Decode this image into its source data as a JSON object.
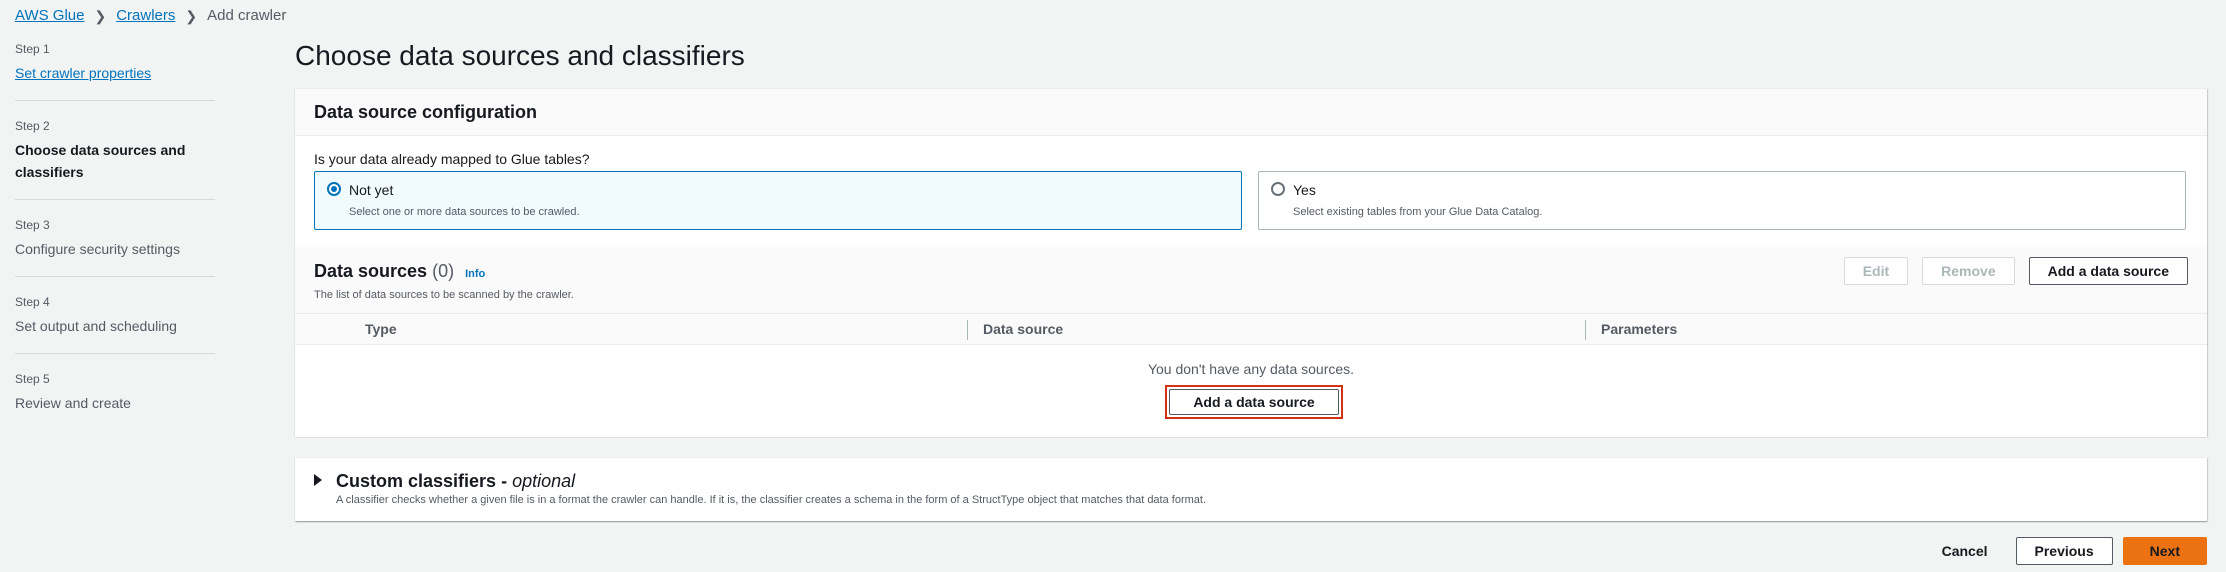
{
  "breadcrumb": {
    "items": [
      "AWS Glue",
      "Crawlers"
    ],
    "current": "Add crawler"
  },
  "steps": [
    {
      "num": "Step 1",
      "title": "Set crawler properties"
    },
    {
      "num": "Step 2",
      "title": "Choose data sources and classifiers"
    },
    {
      "num": "Step 3",
      "title": "Configure security settings"
    },
    {
      "num": "Step 4",
      "title": "Set output and scheduling"
    },
    {
      "num": "Step 5",
      "title": "Review and create"
    }
  ],
  "page_title": "Choose data sources and classifiers",
  "config": {
    "title": "Data source configuration",
    "question": "Is your data already mapped to Glue tables?",
    "options": [
      {
        "label": "Not yet",
        "desc": "Select one or more data sources to be crawled.",
        "selected": true
      },
      {
        "label": "Yes",
        "desc": "Select existing tables from your Glue Data Catalog.",
        "selected": false
      }
    ]
  },
  "data_sources": {
    "title": "Data sources",
    "count": "(0)",
    "info": "Info",
    "desc": "The list of data sources to be scanned by the crawler.",
    "edit": "Edit",
    "remove": "Remove",
    "add": "Add a data source",
    "columns": [
      "Type",
      "Data source",
      "Parameters"
    ],
    "empty_text": "You don't have any data sources.",
    "empty_add": "Add a data source"
  },
  "classifiers": {
    "title": "Custom classifiers - ",
    "optional": "optional",
    "desc": "A classifier checks whether a given file is in a format the crawler can handle. If it is, the classifier creates a schema in the form of a StructType object that matches that data format."
  },
  "footer": {
    "cancel": "Cancel",
    "previous": "Previous",
    "next": "Next"
  },
  "colors": {
    "accent": "#0073bb",
    "primary_button": "#ec7211",
    "highlight_border": "#d13212"
  }
}
